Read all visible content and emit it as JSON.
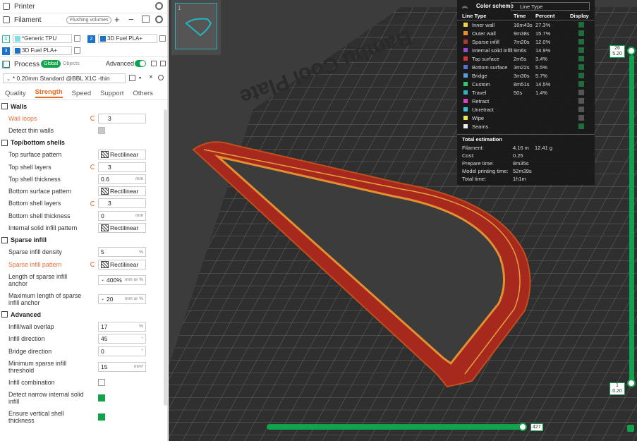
{
  "printer": {
    "title": "Printer"
  },
  "filament": {
    "title": "Filament",
    "flushing_label": "Flushing volumes",
    "items": [
      {
        "num": "1",
        "name": "Generic TPU",
        "color": "#7fe3e6"
      },
      {
        "num": "2",
        "name": "3D Fuel PLA+",
        "color": "#1a73c8"
      },
      {
        "num": "3",
        "name": "3D Fuel PLA+",
        "color": "#1a73c8"
      }
    ]
  },
  "process": {
    "title": "Process",
    "global_label": "Global",
    "objects_label": "Objects",
    "advanced_label": "Advanced",
    "preset": "* 0.20mm Standard @BBL X1C -thin"
  },
  "tabs": [
    "Quality",
    "Strength",
    "Speed",
    "Support",
    "Others"
  ],
  "sections": {
    "walls": {
      "title": "Walls",
      "wall_loops": {
        "label": "Wall loops",
        "value": "3"
      },
      "detect_thin": {
        "label": "Detect thin walls"
      }
    },
    "topbottom": {
      "title": "Top/bottom shells",
      "top_surface_pattern": {
        "label": "Top surface pattern",
        "value": "Rectilinear"
      },
      "top_shell_layers": {
        "label": "Top shell layers",
        "value": "3"
      },
      "top_shell_thickness": {
        "label": "Top shell thickness",
        "value": "0.6",
        "unit": "mm"
      },
      "bottom_surface_pattern": {
        "label": "Bottom surface pattern",
        "value": "Rectilinear"
      },
      "bottom_shell_layers": {
        "label": "Bottom shell layers",
        "value": "3"
      },
      "bottom_shell_thickness": {
        "label": "Bottom shell thickness",
        "value": "0",
        "unit": "mm"
      },
      "internal_solid_pattern": {
        "label": "Internal solid infill pattern",
        "value": "Rectilinear"
      }
    },
    "sparse": {
      "title": "Sparse infill",
      "density": {
        "label": "Sparse infill density",
        "value": "5",
        "unit": "%"
      },
      "pattern": {
        "label": "Sparse infill pattern",
        "value": "Rectilinear"
      },
      "anchor": {
        "label": "Length of sparse infill anchor",
        "value": "400%",
        "unit": "mm or %"
      },
      "max_anchor": {
        "label": "Maximum length of sparse infill anchor",
        "value": "20",
        "unit": "mm or %"
      }
    },
    "advanced": {
      "title": "Advanced",
      "overlap": {
        "label": "Infill/wall overlap",
        "value": "17",
        "unit": "%"
      },
      "infill_dir": {
        "label": "Infill direction",
        "value": "45",
        "unit": "°"
      },
      "bridge_dir": {
        "label": "Bridge direction",
        "value": "0",
        "unit": "°"
      },
      "min_sparse": {
        "label": "Minimum sparse infill threshold",
        "value": "15",
        "unit": "mm²"
      },
      "infill_comb": {
        "label": "Infill combination"
      },
      "narrow_solid": {
        "label": "Detect narrow internal solid infill"
      },
      "vertical_shell": {
        "label": "Ensure vertical shell thickness"
      }
    }
  },
  "plate_text": "Bambu Cool Plate",
  "thumbnail_num": "1",
  "legend": {
    "title": "Color scheme",
    "selected": "Line Type",
    "headers": {
      "type": "Line Type",
      "time": "Time",
      "percent": "Percent",
      "display": "Display"
    },
    "rows": [
      {
        "name": "Inner wall",
        "time": "16m43s",
        "percent": "27.3%",
        "color": "#f4d03f",
        "on": true
      },
      {
        "name": "Outer wall",
        "time": "9m38s",
        "percent": "15.7%",
        "color": "#f08a2c",
        "on": true
      },
      {
        "name": "Sparse infill",
        "time": "7m20s",
        "percent": "12.0%",
        "color": "#b03a2e",
        "on": true
      },
      {
        "name": "Internal solid infill",
        "time": "9m6s",
        "percent": "14.9%",
        "color": "#9b4dd0",
        "on": true
      },
      {
        "name": "Top surface",
        "time": "2m5s",
        "percent": "3.4%",
        "color": "#e03030",
        "on": true
      },
      {
        "name": "Bottom surface",
        "time": "3m22s",
        "percent": "5.5%",
        "color": "#5b6ed6",
        "on": true
      },
      {
        "name": "Bridge",
        "time": "3m30s",
        "percent": "5.7%",
        "color": "#5aa0d8",
        "on": true
      },
      {
        "name": "Custom",
        "time": "8m51s",
        "percent": "14.5%",
        "color": "#2ecc71",
        "on": true
      },
      {
        "name": "Travel",
        "time": "50s",
        "percent": "1.4%",
        "color": "#2bb3c4",
        "on": false
      },
      {
        "name": "Retract",
        "time": "",
        "percent": "",
        "color": "#e040c8",
        "on": false
      },
      {
        "name": "Unretract",
        "time": "",
        "percent": "",
        "color": "#3fc2d8",
        "on": false
      },
      {
        "name": "Wipe",
        "time": "",
        "percent": "",
        "color": "#f2e640",
        "on": false
      },
      {
        "name": "Seams",
        "time": "",
        "percent": "",
        "color": "#eeeeee",
        "on": true
      }
    ],
    "estimation": {
      "title": "Total estimation",
      "rows": [
        {
          "label": "Filament:",
          "v1": "4.16 m",
          "v2": "12.41 g"
        },
        {
          "label": "Cost:",
          "v1": "0.25",
          "v2": ""
        },
        {
          "label": "Prepare time:",
          "v1": "8m35s",
          "v2": ""
        },
        {
          "label": "Model printing time:",
          "v1": "52m39s",
          "v2": ""
        },
        {
          "label": "Total time:",
          "v1": "1h1m",
          "v2": ""
        }
      ]
    }
  },
  "sliders": {
    "top_layer": "26",
    "top_height": "5.20",
    "bottom_layer": "1",
    "bottom_height": "0.20",
    "h_value": "427"
  },
  "colors": {
    "accent": "#11a34c",
    "orange": "#e86a20"
  }
}
